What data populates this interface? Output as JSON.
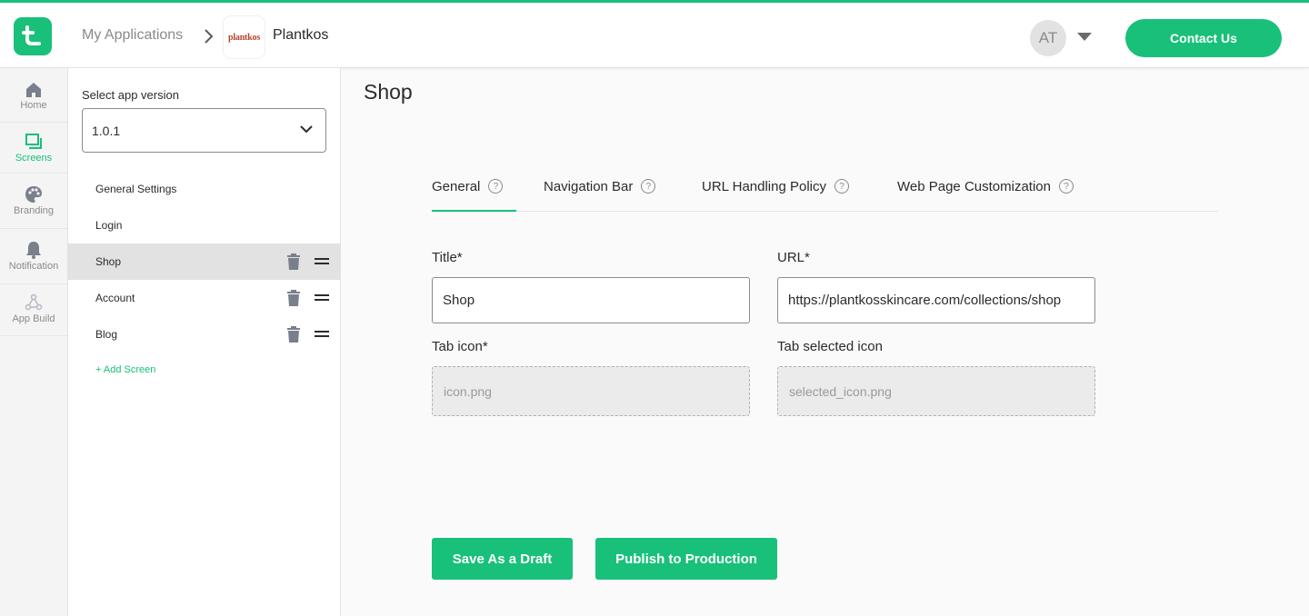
{
  "header": {
    "breadcrumb_root": "My Applications",
    "app_name": "Plantkos",
    "app_logo_text": "plantkos",
    "user_initials": "AT",
    "contact_label": "Contact Us"
  },
  "leftnav": {
    "items": [
      {
        "label": "Home",
        "icon": "home-icon"
      },
      {
        "label": "Screens",
        "icon": "screens-icon",
        "active": true
      },
      {
        "label": "Branding",
        "icon": "palette-icon"
      },
      {
        "label": "Notification",
        "icon": "bell-icon"
      },
      {
        "label": "App Build",
        "icon": "build-icon"
      }
    ]
  },
  "screens_panel": {
    "version_label": "Select app version",
    "version_value": "1.0.1",
    "screens": [
      {
        "name": "General Settings",
        "editable": false
      },
      {
        "name": "Login",
        "editable": false
      },
      {
        "name": "Shop",
        "editable": true,
        "active": true
      },
      {
        "name": "Account",
        "editable": true
      },
      {
        "name": "Blog",
        "editable": true
      }
    ],
    "add_label": "+ Add Screen"
  },
  "main": {
    "title": "Shop",
    "tabs": [
      {
        "label": "General",
        "active": true
      },
      {
        "label": "Navigation Bar"
      },
      {
        "label": "URL Handling Policy"
      },
      {
        "label": "Web Page Customization"
      }
    ],
    "help_glyph": "?",
    "form": {
      "title_label": "Title*",
      "title_value": "Shop",
      "url_label": "URL*",
      "url_value": "https://plantkosskincare.com/collections/shop",
      "tab_icon_label": "Tab icon*",
      "tab_icon_placeholder": "icon.png",
      "tab_selected_label": "Tab selected icon",
      "tab_selected_placeholder": "selected_icon.png"
    },
    "draft_label": "Save As a Draft",
    "publish_label": "Publish to Production"
  },
  "colors": {
    "accent": "#19c07a",
    "text": "#2b2b2b",
    "muted": "#8a8a8a"
  }
}
